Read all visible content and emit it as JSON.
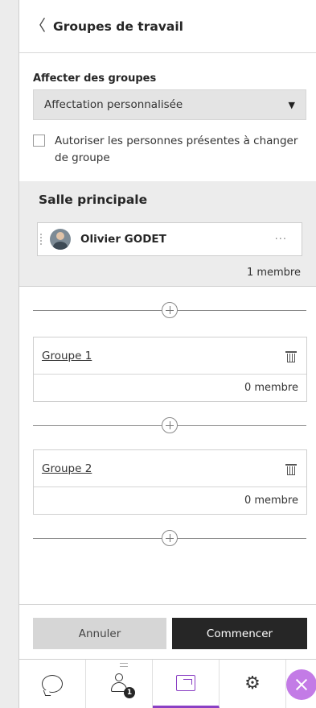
{
  "header": {
    "title": "Groupes de travail",
    "back_icon": "chevron-left-icon"
  },
  "assign": {
    "label": "Affecter des groupes",
    "select_value": "Affectation personnalisée",
    "checkbox_label": "Autoriser les personnes présentes à changer de groupe",
    "checkbox_checked": false
  },
  "main_room": {
    "title": "Salle principale",
    "member_name": "Olivier GODET",
    "more_label": "···",
    "count": "1 membre"
  },
  "groups": [
    {
      "name": "Groupe 1",
      "count": "0 membre"
    },
    {
      "name": "Groupe 2",
      "count": "0 membre"
    }
  ],
  "actions": {
    "cancel_label": "Annuler",
    "start_label": "Commencer"
  },
  "tabbar": {
    "attendees_badge": "1",
    "active_tab": "share",
    "accent_color": "#8a3fc4",
    "close_color": "#c37be6"
  }
}
